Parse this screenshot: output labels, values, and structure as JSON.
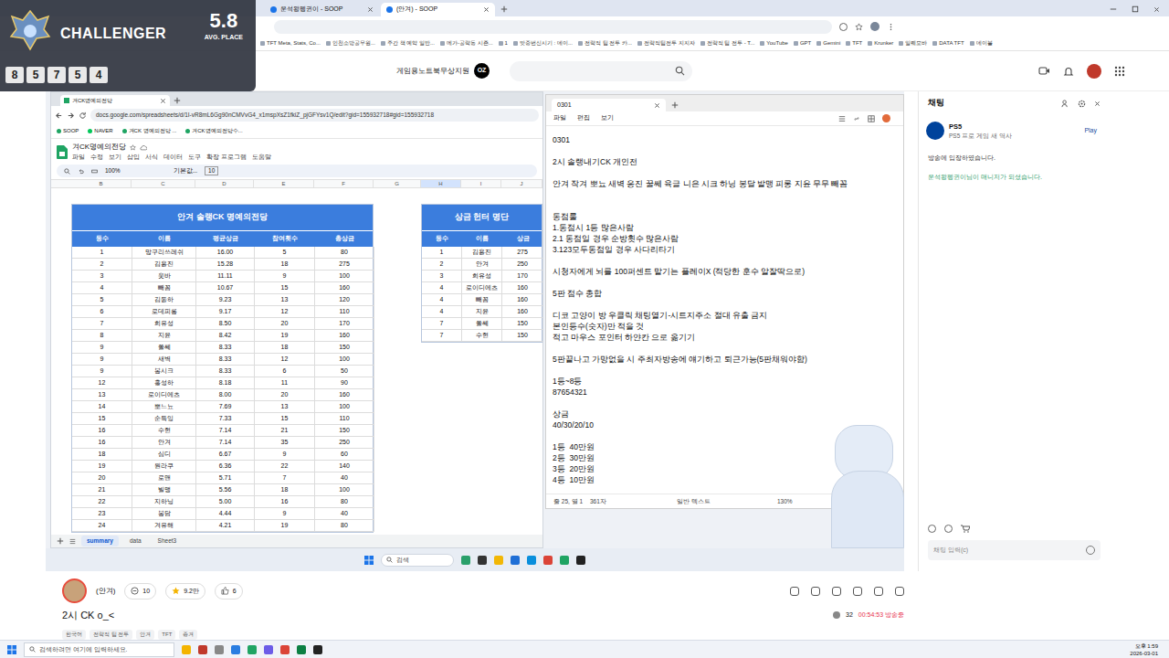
{
  "browser": {
    "tabs": [
      {
        "label": "운석왕펭귄이 - SOOP",
        "selected": false
      },
      {
        "label": "(안겨) - SOOP",
        "selected": true
      }
    ],
    "bookmarks": [
      "TFT Meta, Stats, Co...",
      "인천소방공무원...",
      "주간 책 예약 일반...",
      "메가-공략동 시즌...",
      "1",
      "맛중번신시기 : 데이...",
      "전략적 팀 전투 카...",
      "전략적팀전투 지지자",
      "전략적 팀 전투 - T...",
      "YouTube",
      "GPT",
      "Gemini",
      "TFT",
      "Krunker",
      "일퀘모바",
      "DATA TFT",
      "데이볼"
    ]
  },
  "overlay": {
    "rank": "CHALLENGER",
    "avg": "5.8",
    "avg_label": "AVG. PLACE",
    "placements": [
      "8",
      "5",
      "7",
      "5",
      "4"
    ]
  },
  "header": {
    "promo": "게임용노트북무상지원",
    "badge": "OZ"
  },
  "stream": {
    "sheet": {
      "tab": "겨CK명예의전당",
      "url": "docs.google.com/spreadsheets/d/1I-vR8mL6Gg90nCMVvG4_x1mspXsZ1fkiZ_pjGFYsv1Q/edit?gid=155932718#gid=155932718",
      "bookmarks": [
        "SOOP",
        "NAVER",
        "겨CK 명예의전당 ...",
        "겨CK명예의전당수..."
      ],
      "title": "겨CK명예의전당",
      "menu": [
        "파일",
        "수정",
        "보기",
        "삽입",
        "서식",
        "데이터",
        "도구",
        "확장 프로그램",
        "도움말"
      ],
      "zoom": "100%",
      "font": "기본값...",
      "font_size": "10",
      "columns": [
        "B",
        "C",
        "D",
        "E",
        "F",
        "G",
        "H",
        "I",
        "J"
      ],
      "hall": {
        "title": "안겨 솔랭CK 명예의전당",
        "columns": [
          "등수",
          "이름",
          "평균상금",
          "참여횟수",
          "총상금"
        ],
        "rows": [
          [
            "1",
            "망구리쓰레쉬",
            "16.00",
            "5",
            "80"
          ],
          [
            "2",
            "김용진",
            "15.28",
            "18",
            "275"
          ],
          [
            "3",
            "웃바",
            "11.11",
            "9",
            "100"
          ],
          [
            "4",
            "빼꼼",
            "10.67",
            "15",
            "160"
          ],
          [
            "5",
            "김동하",
            "9.23",
            "13",
            "120"
          ],
          [
            "6",
            "로데피롱",
            "9.17",
            "12",
            "110"
          ],
          [
            "7",
            "희유성",
            "8.50",
            "20",
            "170"
          ],
          [
            "8",
            "지윤",
            "8.42",
            "19",
            "160"
          ],
          [
            "9",
            "쫄쎄",
            "8.33",
            "18",
            "150"
          ],
          [
            "9",
            "새벽",
            "8.33",
            "12",
            "100"
          ],
          [
            "9",
            "봉시크",
            "8.33",
            "6",
            "50"
          ],
          [
            "12",
            "홍성하",
            "8.18",
            "11",
            "90"
          ],
          [
            "13",
            "로이디에츠",
            "8.00",
            "20",
            "160"
          ],
          [
            "14",
            "뽀느뇨",
            "7.69",
            "13",
            "100"
          ],
          [
            "15",
            "순득잉",
            "7.33",
            "15",
            "110"
          ],
          [
            "16",
            "수현",
            "7.14",
            "21",
            "150"
          ],
          [
            "16",
            "안겨",
            "7.14",
            "35",
            "250"
          ],
          [
            "18",
            "심디",
            "6.67",
            "9",
            "60"
          ],
          [
            "19",
            "원라쿠",
            "6.36",
            "22",
            "140"
          ],
          [
            "20",
            "로맨",
            "5.71",
            "7",
            "40"
          ],
          [
            "21",
            "빌맹",
            "5.56",
            "18",
            "100"
          ],
          [
            "22",
            "지하닝",
            "5.00",
            "16",
            "80"
          ],
          [
            "23",
            "봉담",
            "4.44",
            "9",
            "40"
          ],
          [
            "24",
            "겨유해",
            "4.21",
            "19",
            "80"
          ]
        ]
      },
      "hunters": {
        "title": "상금 헌터 명단",
        "columns": [
          "등수",
          "이름",
          "상금"
        ],
        "rows": [
          [
            "1",
            "김용진",
            "275"
          ],
          [
            "2",
            "안겨",
            "250"
          ],
          [
            "3",
            "희유성",
            "170"
          ],
          [
            "4",
            "로이디에츠",
            "160"
          ],
          [
            "4",
            "빼꼼",
            "160"
          ],
          [
            "4",
            "지윤",
            "160"
          ],
          [
            "7",
            "쫄쎄",
            "150"
          ],
          [
            "7",
            "수현",
            "150"
          ]
        ]
      },
      "sheet_tabs": [
        {
          "label": "summary",
          "selected": true
        },
        {
          "label": "data",
          "selected": false
        },
        {
          "label": "Sheet3",
          "selected": false
        }
      ]
    },
    "notepad": {
      "tab": "0301",
      "menu": [
        "파일",
        "편집",
        "보기"
      ],
      "lines": [
        "0301",
        "",
        "2시 솔랭내기CK 개인전",
        "",
        "안겨 작겨 뽀뇨 새벽 응진 꿀쎄 육글 니은 시크 하닝 봉달 발맹 피롱 지윤 무무 빼꼼",
        "",
        "",
        "동점룰",
        "1.동점시 1등 많은사람",
        "2.1 동점일 경우 순방횟수 많은사람",
        "3.123모두동점일 경우 사다리타기",
        "",
        "시청자에게 뇌를 100퍼센트 맡기는 플레이X (적당한 훈수 알잘딱으로)",
        "",
        "5판 점수 총합",
        "",
        "디코 고양이 방 우클릭 채팅열기-시트지주소 절대 유출 금지",
        "본인등수(숫자)만 적을 것",
        "적고 마우스 포인터 하얀칸 으로 옮기기",
        "",
        "5판끝나고 가망없을 시 주최자방송에 얘기하고 퇴근가능(5판채워야함)",
        "",
        "1등~8등",
        "87654321",
        "",
        "상금",
        "40/30/20/10",
        "",
        "1등  40만원",
        "2등  30만원",
        "3등  20만원",
        "4등  10만원"
      ],
      "status": [
        "줄 25, 열 1",
        "361자",
        "일반 텍스트",
        "130%"
      ]
    },
    "taskbar": {
      "search": "검색"
    }
  },
  "chat": {
    "title": "채팅",
    "promo": {
      "name": "PS5",
      "desc": "PS5 프로 게임 새 역사",
      "action": "Play"
    },
    "messages": [
      {
        "text": "방송에 입장하였습니다.",
        "color": "#333333"
      },
      {
        "text": "운석왕펭귄이님이 매니저가 되셨습니다.",
        "color": "#2e9e6a"
      }
    ],
    "placeholder": "채팅 입력(c)"
  },
  "info": {
    "streamer": "(안겨)",
    "stats": [
      "10",
      "9.2만",
      "6"
    ],
    "title": "2시 CK o_<",
    "tags": [
      "한국어",
      "전략적 팀 전투",
      "안겨",
      "TFT",
      "종겨"
    ],
    "viewers": "32",
    "live": "00:54:53 방송중"
  },
  "taskbar": {
    "search": "검색하려면 여기에 입력하세요.",
    "time": "오후 1:59",
    "date": "2026-03-01"
  }
}
